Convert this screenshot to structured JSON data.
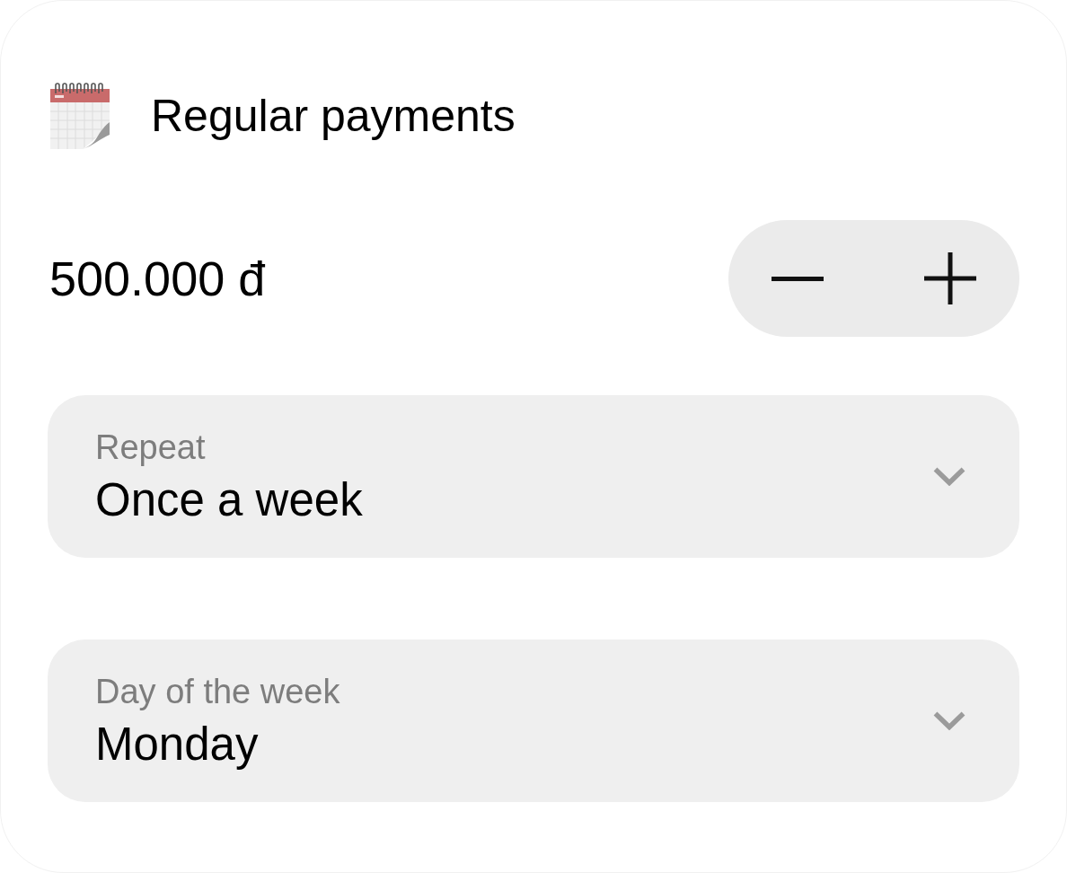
{
  "header": {
    "title": "Regular payments"
  },
  "amount": {
    "value": "500.000 đ"
  },
  "fields": [
    {
      "label": "Repeat",
      "value": "Once a week"
    },
    {
      "label": "Day of the week",
      "value": "Monday"
    }
  ]
}
